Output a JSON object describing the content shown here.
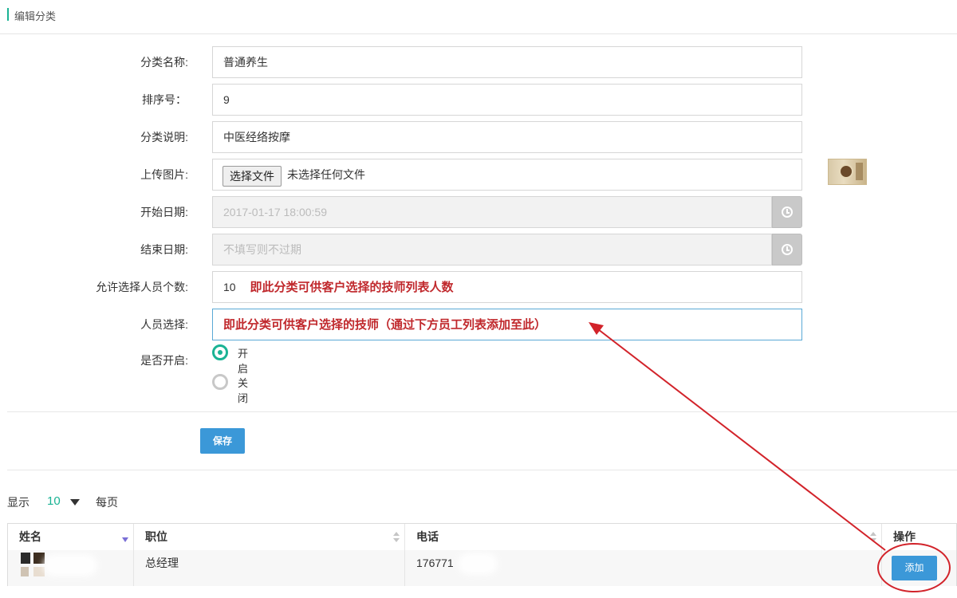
{
  "header": {
    "title": "编辑分类"
  },
  "form": {
    "category_name": {
      "label": "分类名称:",
      "value": "普通养生"
    },
    "sort_no": {
      "label": "排序号：",
      "value": "9"
    },
    "description": {
      "label": "分类说明:",
      "value": "中医经络按摩"
    },
    "upload": {
      "label": "上传图片:",
      "button": "选择文件",
      "status": "未选择任何文件"
    },
    "start_date": {
      "label": "开始日期:",
      "value": "2017-01-17 18:00:59"
    },
    "end_date": {
      "label": "结束日期:",
      "placeholder": "不填写则不过期"
    },
    "allow_count": {
      "label": "允许选择人员个数:",
      "value": "10",
      "note": "即此分类可供客户选择的技师列表人数"
    },
    "staff_select": {
      "label": "人员选择:",
      "note": "即此分类可供客户选择的技师（通过下方员工列表添加至此）"
    },
    "enabled": {
      "label": "是否开启:",
      "options": [
        "开启",
        "关闭"
      ],
      "selected": "开启"
    },
    "save_label": "保存"
  },
  "table": {
    "page_size_prefix": "显示",
    "page_size": "10",
    "page_size_suffix": "每页",
    "columns": [
      "姓名",
      "职位",
      "电话",
      "操作"
    ],
    "rows": [
      {
        "name": "",
        "position": "总经理",
        "phone": "176771",
        "action": "添加"
      }
    ]
  },
  "colors": {
    "accent": "#1ab394",
    "primary_button": "#3b98d8",
    "annotation": "#d2232a"
  }
}
